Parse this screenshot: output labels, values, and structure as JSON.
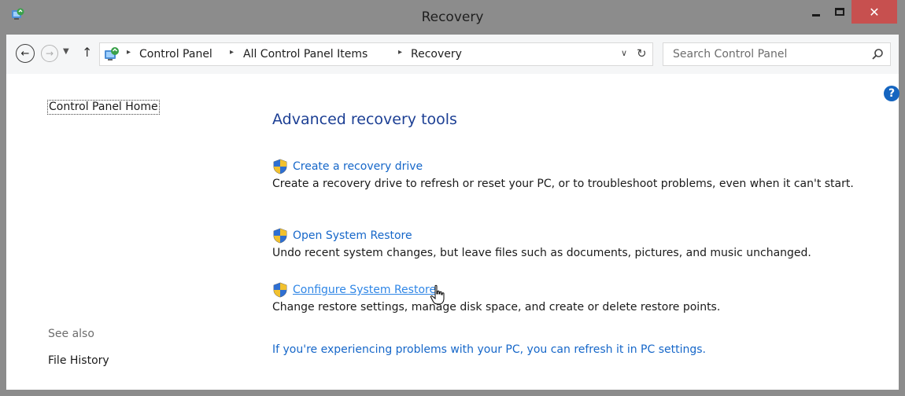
{
  "window": {
    "title": "Recovery",
    "close_glyph": "✕"
  },
  "nav": {
    "back_glyph": "←",
    "forward_glyph": "→",
    "recent_glyph": "▼",
    "up_glyph": "↑",
    "breadcrumbs": [
      "Control Panel",
      "All Control Panel Items",
      "Recovery"
    ],
    "breadcrumb_separator": "▸",
    "dropdown_glyph": "∨",
    "refresh_glyph": "↻",
    "search_placeholder": "Search Control Panel"
  },
  "sidebar": {
    "home_label": "Control Panel Home",
    "see_also_label": "See also",
    "file_history_label": "File History"
  },
  "main": {
    "help_glyph": "?",
    "section_title": "Advanced recovery tools",
    "tools": [
      {
        "label": "Create a recovery drive",
        "description": "Create a recovery drive to refresh or reset your PC, or to troubleshoot problems, even when it can't start."
      },
      {
        "label": "Open System Restore",
        "description": "Undo recent system changes, but leave files such as documents, pictures, and music unchanged."
      },
      {
        "label": "Configure System Restore",
        "description": "Change restore settings, manage disk space, and create or delete restore points."
      }
    ],
    "pc_settings_link": "If you're experiencing problems with your PC, you can refresh it in PC settings."
  },
  "colors": {
    "titlebar": "#8c8c8c",
    "close_button": "#c7504f",
    "link": "#1667c9",
    "section_title": "#1c3f94"
  }
}
